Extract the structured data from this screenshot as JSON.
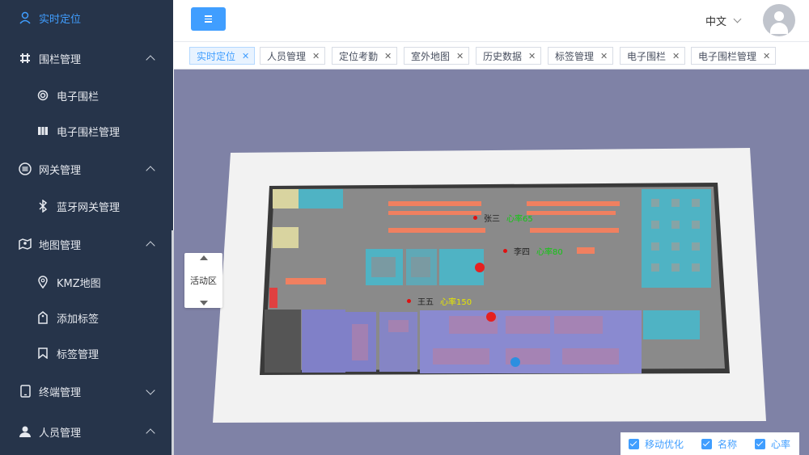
{
  "sidebar": {
    "items": [
      {
        "label": "实时定位",
        "icon": "location-pin-icon",
        "active": true
      },
      {
        "label": "围栏管理",
        "icon": "grid-icon",
        "expanded": true
      },
      {
        "label": "电子围栏",
        "icon": "target-icon"
      },
      {
        "label": "电子围栏管理",
        "icon": "map-book-icon"
      },
      {
        "label": "网关管理",
        "icon": "list-circle-icon",
        "expanded": true
      },
      {
        "label": "蓝牙网关管理",
        "icon": "bluetooth-icon"
      },
      {
        "label": "地图管理",
        "icon": "map-icon",
        "expanded": true
      },
      {
        "label": "KMZ地图",
        "icon": "map-marker-icon"
      },
      {
        "label": "添加标签",
        "icon": "tag-add-icon"
      },
      {
        "label": "标签管理",
        "icon": "bookmark-icon"
      },
      {
        "label": "终端管理",
        "icon": "tablet-icon",
        "expanded": false
      },
      {
        "label": "人员管理",
        "icon": "user-icon",
        "expanded": true
      }
    ]
  },
  "header": {
    "menu_icon": "hamburger-icon",
    "language": "中文",
    "avatar_icon": "user-avatar-icon"
  },
  "tabs": [
    {
      "label": "实时定位",
      "active": true
    },
    {
      "label": "人员管理"
    },
    {
      "label": "定位考勤"
    },
    {
      "label": "室外地图"
    },
    {
      "label": "历史数据"
    },
    {
      "label": "标签管理"
    },
    {
      "label": "电子围栏"
    },
    {
      "label": "电子围栏管理"
    }
  ],
  "map": {
    "zone_selector": {
      "label": "活动区"
    },
    "people": [
      {
        "name": "张三",
        "heart_rate": "心率65"
      },
      {
        "name": "李四",
        "heart_rate": "心率80"
      },
      {
        "name": "王五",
        "heart_rate": "心率150"
      }
    ],
    "options": [
      {
        "label": "移动优化",
        "checked": true
      },
      {
        "label": "名称",
        "checked": true
      },
      {
        "label": "心率",
        "checked": true
      }
    ]
  },
  "colors": {
    "sidebar_bg": "#26344a",
    "accent": "#409eff",
    "map_bg": "#7f82a6",
    "heart_rate_normal": "#12c712",
    "heart_rate_high": "#e6e600"
  }
}
